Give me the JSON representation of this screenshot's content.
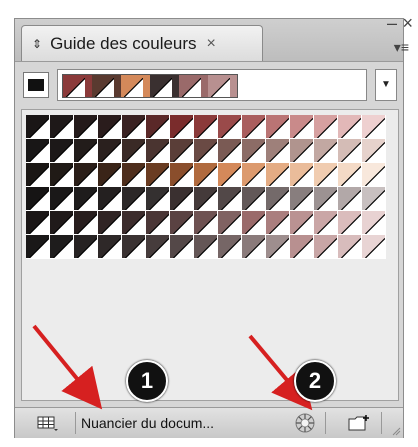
{
  "panel": {
    "tab_title": "Guide des couleurs",
    "tab_arrows_icon": "updown-arrows-icon",
    "tab_close_glyph": "×",
    "minimize_glyph": "–",
    "close_glyph": "×",
    "menu_glyph": "▾≡"
  },
  "active_color": "#111111",
  "harmony_colors": [
    "#8b3a3a",
    "#5a3a30",
    "#d4895a",
    "#3a3030",
    "#9a6a6a",
    "#b89090"
  ],
  "dropdown_glyph": "▼",
  "grid": {
    "rows": [
      [
        "#1a1616",
        "#1e1818",
        "#241a1a",
        "#2a1c1c",
        "#3a2222",
        "#5a2828",
        "#7a2c2c",
        "#8b3a3a",
        "#9a4a4a",
        "#aa5e5e",
        "#ba7474",
        "#c98a8a",
        "#d6a0a0",
        "#e2b8b8",
        "#eed0d0"
      ],
      [
        "#181616",
        "#1c1818",
        "#221c1a",
        "#2a201e",
        "#3a2a26",
        "#4a3430",
        "#5a3e38",
        "#6a4a44",
        "#7a5a54",
        "#8c6c66",
        "#9e807a",
        "#b0948e",
        "#c2a8a2",
        "#d4bcb6",
        "#e6d2cc"
      ],
      [
        "#1a1614",
        "#201a16",
        "#2a1e18",
        "#3a2418",
        "#4e2e1c",
        "#6a3c22",
        "#8a4e2c",
        "#b06a3e",
        "#d4895a",
        "#dc9a6e",
        "#e4ac84",
        "#eabc9a",
        "#f0ccb0",
        "#f4dac6",
        "#f8e8dc"
      ],
      [
        "#161414",
        "#1a1818",
        "#1e1c1c",
        "#242020",
        "#2c2828",
        "#343030",
        "#3a3030",
        "#443a3a",
        "#524848",
        "#625858",
        "#746a6a",
        "#887e7e",
        "#9c9292",
        "#b2a8a8",
        "#c8c0c0"
      ],
      [
        "#1a1616",
        "#201a1a",
        "#281e1e",
        "#302424",
        "#3c2c2c",
        "#4a3636",
        "#5a4242",
        "#6e5252",
        "#806262",
        "#9a6a6a",
        "#aa7e7e",
        "#ba9292",
        "#caa6a6",
        "#dabcbc",
        "#e8d2d2"
      ],
      [
        "#1a1818",
        "#1e1c1c",
        "#262222",
        "#2e2828",
        "#3a3232",
        "#463c3c",
        "#544848",
        "#645656",
        "#766666",
        "#8a7a7a",
        "#9e8e8e",
        "#b89090",
        "#c8a6a6",
        "#d8bcbc",
        "#e8d4d4"
      ]
    ]
  },
  "bottom": {
    "library_icon": "swatch-library-icon",
    "library_name": "Nuancier du docum...",
    "color_wheel_icon": "color-wheel-icon",
    "new_group_icon": "new-swatch-group-icon"
  },
  "callouts": [
    "1",
    "2"
  ],
  "arrow_color": "#d62020"
}
